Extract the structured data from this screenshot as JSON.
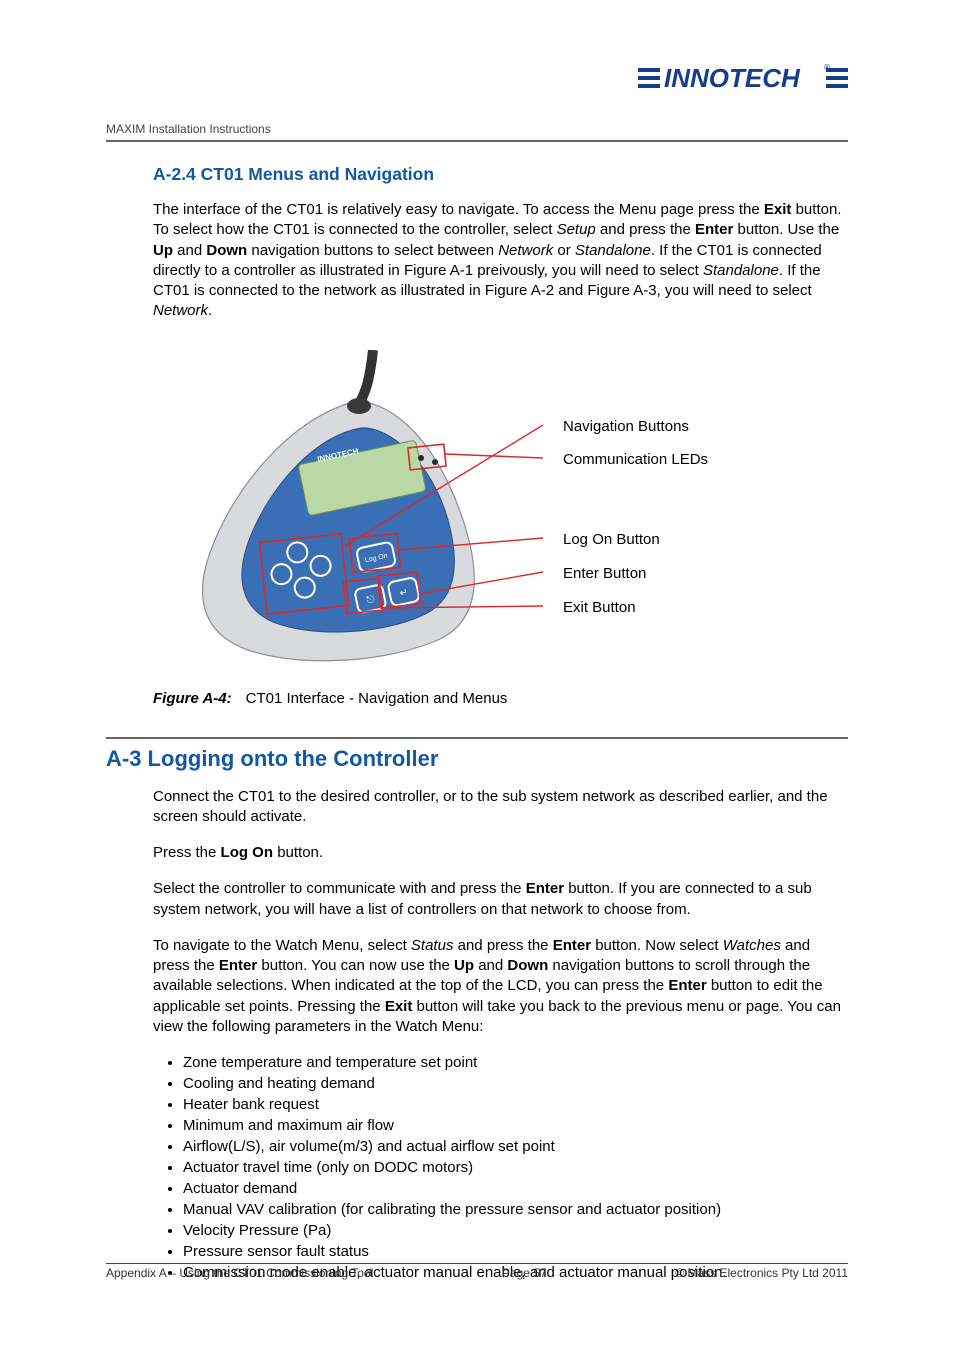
{
  "doc_title": "MAXIM Installation Instructions",
  "logo_text": "INNOTECH",
  "sections": {
    "a24": {
      "heading": "A-2.4  CT01 Menus and Navigation",
      "para1_pre": "The interface of the CT01 is relatively easy to navigate.  To access the Menu page press the ",
      "para1_b1": "Exit",
      "para1_mid1": " button.  To select how the CT01 is connected to the controller, select ",
      "para1_i1": "Setup",
      "para1_mid2": " and press the ",
      "para1_b2": "Enter",
      "para1_mid3": " button.   Use the ",
      "para1_b3": "Up",
      "para1_mid4": " and ",
      "para1_b4": "Down",
      "para1_mid5": " navigation buttons to select between ",
      "para1_i2": "Network",
      "para1_mid6": " or ",
      "para1_i3": "Standalone",
      "para1_mid7": ".  If the CT01 is connected directly to a controller as illustrated in Figure A-1 preivously, you will need to select ",
      "para1_i4": "Standalone",
      "para1_mid8": ".  If the CT01 is connected to the network as illustrated in Figure A-2 and Figure A-3, you will need to select ",
      "para1_i5": "Network",
      "para1_end": "."
    },
    "figure": {
      "id": "Figure A-4:",
      "caption": "CT01 Interface - Navigation and Menus",
      "labels": {
        "nav": "Navigation Buttons",
        "comm": "Communication LEDs",
        "logon": "Log On Button",
        "enter": "Enter Button",
        "exit": "Exit Button"
      },
      "device_brand": "INNOTECH",
      "device_btn": "Log On"
    },
    "a3": {
      "heading": "A-3  Logging onto the Controller",
      "p1": "Connect the CT01 to the desired controller, or to the sub system network as described earlier, and the screen should activate.",
      "p2_pre": "Press the ",
      "p2_b": "Log On",
      "p2_end": " button.",
      "p3_pre": "Select the controller to communicate with and press the ",
      "p3_b": "Enter",
      "p3_end": " button.  If you are connected to a sub system network, you will have a list of controllers on that network to choose from.",
      "p4_pre": "To navigate to the Watch Menu, select ",
      "p4_i1": "Status",
      "p4_m1": " and press the ",
      "p4_b1": "Enter",
      "p4_m2": " button.  Now select ",
      "p4_i2": "Watches",
      "p4_m3": " and press the ",
      "p4_b2": "Enter",
      "p4_m4": " button.  You can now use the ",
      "p4_b3": "Up",
      "p4_m5": " and ",
      "p4_b4": "Down",
      "p4_m6": " navigation buttons to scroll through the available selections.  When indicated at the top of the LCD, you can press the ",
      "p4_b5": "Enter",
      "p4_m7": " button to edit the applicable set points.  Pressing the ",
      "p4_b6": "Exit",
      "p4_m8": " button will take you back to the previous menu or page.  You can view the following parameters in the Watch Menu:",
      "list": [
        "Zone temperature and temperature set point",
        "Cooling and heating demand",
        "Heater bank request",
        "Minimum and maximum air flow",
        "Airflow(L/S), air volume(m/3) and actual airflow set point",
        "Actuator travel time (only on DODC motors)",
        "Actuator demand",
        "Manual VAV calibration (for calibrating the pressure sensor and actuator position)",
        "Velocity Pressure (Pa)",
        "Pressure sensor fault status",
        "Commission mode enable, actuator manual enable, and actuator manual position."
      ]
    }
  },
  "footer": {
    "left": "Appendix A – Using the CT01 Commissioning Tool",
    "center": "Page 57",
    "right": "©  Mass Electronics Pty Ltd  2011"
  }
}
